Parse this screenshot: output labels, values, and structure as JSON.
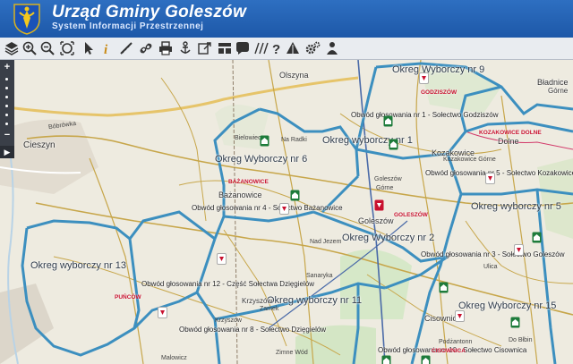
{
  "header": {
    "title": "Urząd Gminy Goleszów",
    "subtitle": "System Informacji Przestrzennej"
  },
  "toolbar": {
    "tools": [
      {
        "name": "layers-icon"
      },
      {
        "name": "zoom-in-icon"
      },
      {
        "name": "zoom-out-icon"
      },
      {
        "name": "zoom-extent-icon"
      },
      {
        "name": "select-cursor-icon"
      },
      {
        "name": "info-icon"
      },
      {
        "name": "measure-icon"
      },
      {
        "name": "link-icon"
      },
      {
        "name": "print-icon"
      },
      {
        "name": "anchor-icon"
      },
      {
        "name": "export-icon"
      },
      {
        "name": "layout-icon"
      },
      {
        "name": "comment-icon"
      },
      {
        "name": "hatch-icon"
      },
      {
        "name": "help-icon"
      },
      {
        "name": "triangle-icon"
      },
      {
        "name": "settings-icon"
      },
      {
        "name": "user-location-icon"
      }
    ]
  },
  "rail": {
    "zoom_in": "+",
    "zoom_out": "−",
    "arrow": "▶"
  },
  "map": {
    "districts": [
      {
        "id": "9",
        "label": "Okreg Wyborczy nr 9"
      },
      {
        "id": "6",
        "label": "Okreg Wyborczy nr 6"
      },
      {
        "id": "1",
        "label": "Okreg wyborczy nr 1"
      },
      {
        "id": "5",
        "label": "Okreg wyborczy nr 5"
      },
      {
        "id": "2",
        "label": "Okreg Wyborczy nr 2"
      },
      {
        "id": "13",
        "label": "Okreg wyborczy nr 13"
      },
      {
        "id": "11",
        "label": "Okreg wyborczy nr 11"
      },
      {
        "id": "15",
        "label": "Okreg Wyborczy nr 15"
      }
    ],
    "circuits": [
      {
        "id": "godziszow",
        "label": "Obwód głosowania nr 1 - Sołectwo Godziszów"
      },
      {
        "id": "bazanowice",
        "label": "Obwód głosowania nr 4 - Sołectwo Bażanowice"
      },
      {
        "id": "kozakowice",
        "label": "Obwód głosowania nr 5 - Sołectwo Kozakowice"
      },
      {
        "id": "goleszow",
        "label": "Obwód głosowania nr 3 - Sołectwo Goleszów"
      },
      {
        "id": "dzieglowiec-part",
        "label": "Obwód głosowania nr 12 - Część Sołectwa Dzięgielów"
      },
      {
        "id": "dzieglowiec",
        "label": "Obwód głosowania nr 8 - Sołectwo Dzięgielów"
      },
      {
        "id": "cisownica",
        "label": "Obwód głosowania nr 10 - Sołectwo Cisownica"
      }
    ],
    "towns": [
      {
        "id": "cieszyn",
        "label": "Cieszyn"
      },
      {
        "id": "olszyna",
        "label": "Olszyna"
      },
      {
        "id": "bazanowice",
        "label": "Bażanowice"
      },
      {
        "id": "kozakowice",
        "label": "Kozakowice"
      },
      {
        "id": "goleszow",
        "label": "Goleszów"
      },
      {
        "id": "cisownica",
        "label": "Cisownica"
      },
      {
        "id": "dolne",
        "label": "Dolne"
      },
      {
        "id": "bladnice",
        "label": "Bładnice"
      },
      {
        "id": "gorne",
        "label": "Górne"
      },
      {
        "id": "krzyszow",
        "label": "Krzyszów"
      }
    ],
    "red_labels": [
      {
        "id": "godziszow",
        "label": "GODZISZÓW"
      },
      {
        "id": "bazanowice",
        "label": "BAŻANOWICE"
      },
      {
        "id": "kozakowice",
        "label": "KOZAKOWICE DOLNE"
      },
      {
        "id": "goleszow",
        "label": "GOLESZÓW"
      },
      {
        "id": "punkow",
        "label": "PUŃCÓW"
      },
      {
        "id": "cisownica",
        "label": "CISOWNICA"
      }
    ],
    "minor": [
      {
        "id": "boborowka",
        "label": "Bóbrówka"
      },
      {
        "id": "zimnowod",
        "label": "Zimne Wód"
      },
      {
        "id": "radki",
        "label": "Na Radki"
      },
      {
        "id": "bielowiec",
        "label": "Bielowiec"
      },
      {
        "id": "kozakowice-gorne",
        "label": "Kozakowice Górne"
      },
      {
        "id": "podzantonn",
        "label": "Podżantonn"
      },
      {
        "id": "dobibin",
        "label": "Do Błbin"
      },
      {
        "id": "ulica",
        "label": "Ulica"
      },
      {
        "id": "goleszow2",
        "label": "Goleszów"
      },
      {
        "id": "gorne2",
        "label": "Górne"
      },
      {
        "id": "sanaryka",
        "label": "Sanaryka"
      },
      {
        "id": "nadj",
        "label": "Nad Jezem"
      },
      {
        "id": "krzyszow2",
        "label": "Krzyszów"
      },
      {
        "id": "ulica2",
        "label": "Zamek"
      },
      {
        "id": "mcisowa",
        "label": "Malowicz"
      }
    ]
  }
}
